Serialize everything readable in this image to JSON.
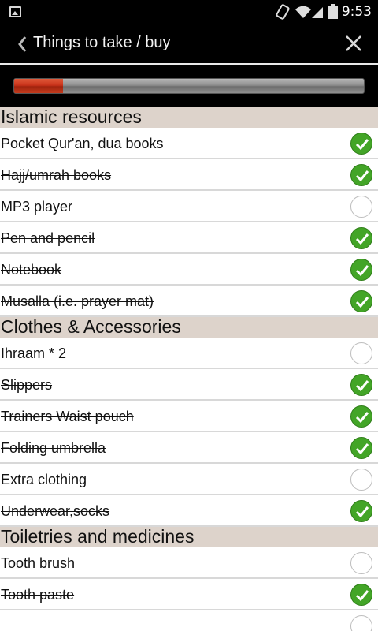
{
  "status_bar": {
    "time": "9:53"
  },
  "header": {
    "title": "Things to take / buy"
  },
  "progress": {
    "fraction": 0.14,
    "track_color": "#8d8d8d",
    "fill_color": "#c8321a"
  },
  "colors": {
    "check_on": "#43a527",
    "section_bg": "#ddd3cb"
  },
  "sections": [
    {
      "title": "Islamic resources",
      "items": [
        {
          "label": "Pocket Qur'an, dua books",
          "checked": true
        },
        {
          "label": "Hajj/umrah books",
          "checked": true
        },
        {
          "label": "MP3 player",
          "checked": false
        },
        {
          "label": "Pen and pencil",
          "checked": true
        },
        {
          "label": "Notebook",
          "checked": true
        },
        {
          "label": "Musalla (i.e. prayer mat)",
          "checked": true
        }
      ]
    },
    {
      "title": "Clothes & Accessories",
      "items": [
        {
          "label": "Ihraam * 2",
          "checked": false
        },
        {
          "label": "Slippers",
          "checked": true
        },
        {
          "label": "Trainers Waist pouch",
          "checked": true
        },
        {
          "label": "Folding umbrella",
          "checked": true
        },
        {
          "label": "Extra clothing",
          "checked": false
        },
        {
          "label": "Underwear,socks",
          "checked": true
        }
      ]
    },
    {
      "title": "Toiletries and medicines",
      "items": [
        {
          "label": "Tooth brush",
          "checked": false
        },
        {
          "label": "Tooth paste",
          "checked": true
        },
        {
          "label": "",
          "checked": false
        }
      ]
    }
  ]
}
